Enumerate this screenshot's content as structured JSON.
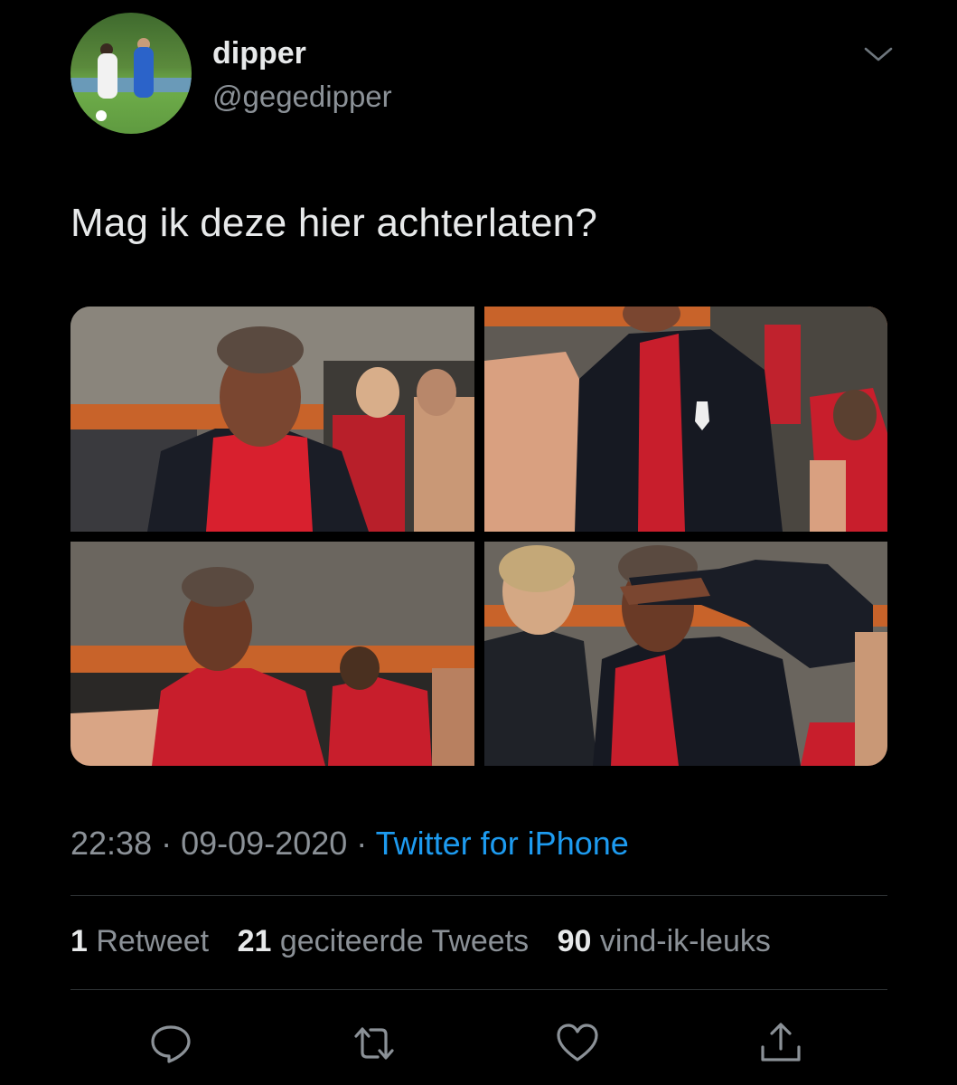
{
  "user": {
    "display_name": "dipper",
    "handle": "@gegedipper"
  },
  "tweet": {
    "text": "Mag ik deze hier achterlaten?",
    "time": "22:38",
    "date": "09-09-2020",
    "separator": "·",
    "source": "Twitter for iPhone"
  },
  "stats": {
    "retweets_count": "1",
    "retweets_label": "Retweet",
    "quotes_count": "21",
    "quotes_label": "geciteerde Tweets",
    "likes_count": "90",
    "likes_label": "vind-ik-leuks"
  },
  "icons": {
    "reply": "reply-icon",
    "retweet": "retweet-icon",
    "like": "heart-icon",
    "share": "share-icon",
    "more": "chevron-down-icon"
  },
  "colors": {
    "background": "#000000",
    "text": "#e7e9ea",
    "secondary": "#8b9197",
    "link": "#1d9bf0",
    "divider": "#2f3336"
  }
}
